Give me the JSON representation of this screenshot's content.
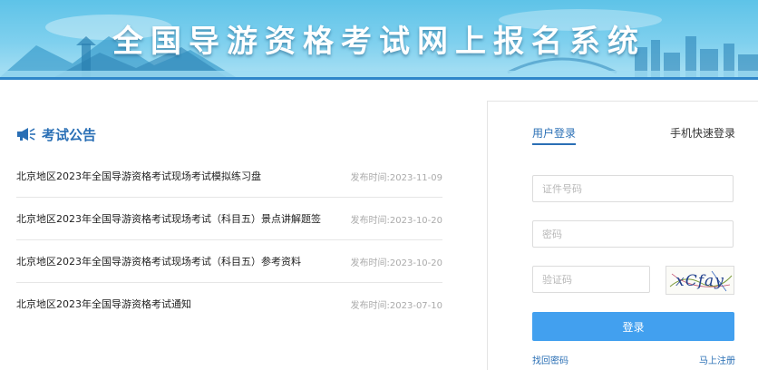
{
  "banner": {
    "title": "全国导游资格考试网上报名系统"
  },
  "notices": {
    "title": "考试公告",
    "items": [
      {
        "text": "北京地区2023年全国导游资格考试现场考试模拟练习盘",
        "date": "发布时间:2023-11-09"
      },
      {
        "text": "北京地区2023年全国导游资格考试现场考试（科目五）景点讲解题签",
        "date": "发布时间:2023-10-20"
      },
      {
        "text": "北京地区2023年全国导游资格考试现场考试（科目五）参考资料",
        "date": "发布时间:2023-10-20"
      },
      {
        "text": "北京地区2023年全国导游资格考试通知",
        "date": "发布时间:2023-07-10"
      }
    ]
  },
  "login": {
    "tab_user": "用户登录",
    "tab_phone": "手机快速登录",
    "id_placeholder": "证件号码",
    "password_placeholder": "密码",
    "captcha_placeholder": "验证码",
    "captcha_text": "xCfay",
    "submit_label": "登录",
    "forgot_label": "找回密码",
    "register_label": "马上注册"
  },
  "colors": {
    "accent": "#2a6fb5",
    "button": "#42a0ef",
    "banner": "#5ec3e8"
  }
}
